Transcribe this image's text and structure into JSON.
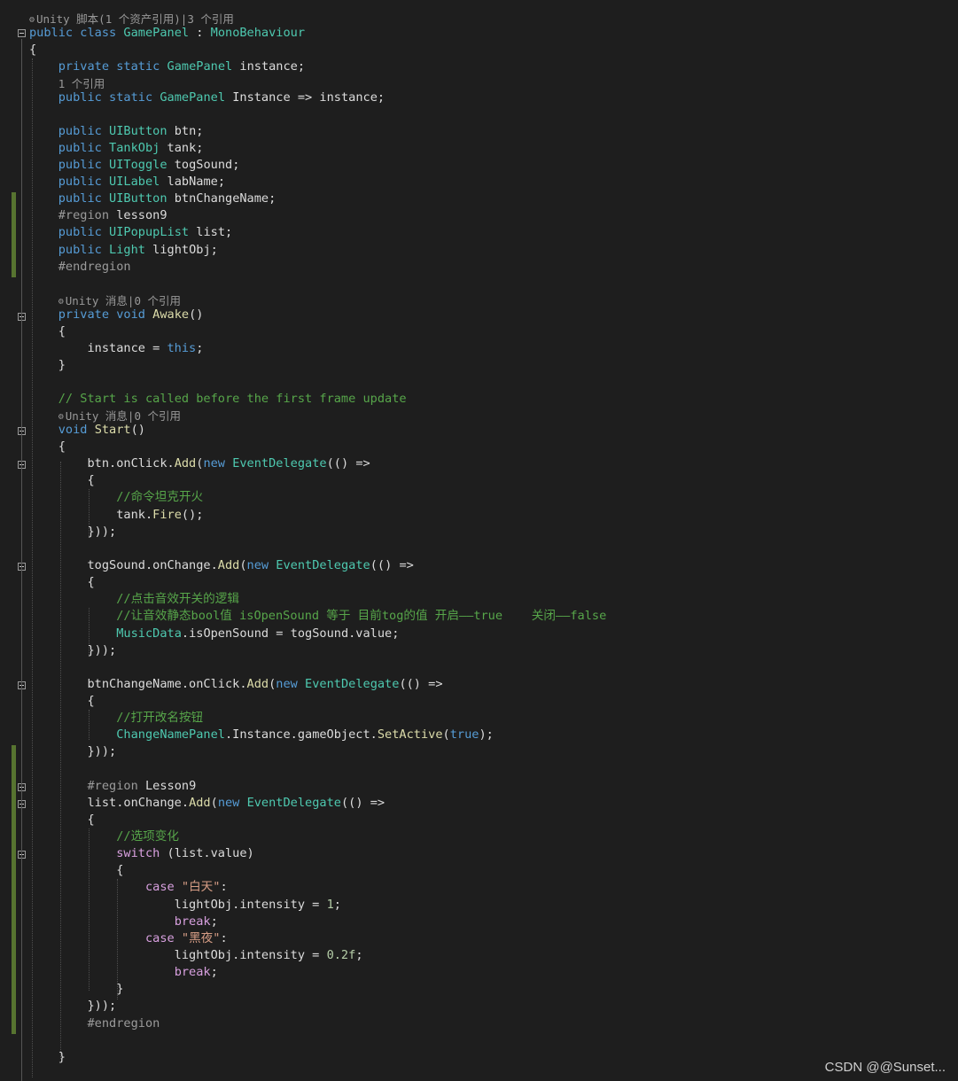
{
  "theme": {
    "background": "#1e1e1e",
    "keyword": "#569cd6",
    "type": "#4ec9b0",
    "method": "#dcdcaa",
    "string": "#d69d85",
    "comment": "#57a64a",
    "number": "#b5cea8",
    "control": "#d8a0df",
    "preprocessor": "#9b9b9b",
    "codelens": "#999999",
    "change_bar": "#577430"
  },
  "code_lines": [
    {
      "kind": "lens",
      "icon": "unity-icon",
      "text": "Unity 脚本(1 个资产引用)|3 个引用"
    },
    {
      "tokens": [
        [
          "kw",
          "public"
        ],
        [
          "p",
          " "
        ],
        [
          "kw",
          "class"
        ],
        [
          "p",
          " "
        ],
        [
          "type",
          "GamePanel"
        ],
        [
          "p",
          " : "
        ],
        [
          "type",
          "MonoBehaviour"
        ]
      ]
    },
    {
      "tokens": [
        [
          "p",
          "{"
        ]
      ]
    },
    {
      "tokens": [
        [
          "p",
          "    "
        ],
        [
          "kw",
          "private"
        ],
        [
          "p",
          " "
        ],
        [
          "kw",
          "static"
        ],
        [
          "p",
          " "
        ],
        [
          "type",
          "GamePanel"
        ],
        [
          "p",
          " instance;"
        ]
      ]
    },
    {
      "kind": "lens",
      "text": "    1 个引用"
    },
    {
      "tokens": [
        [
          "p",
          "    "
        ],
        [
          "kw",
          "public"
        ],
        [
          "p",
          " "
        ],
        [
          "kw",
          "static"
        ],
        [
          "p",
          " "
        ],
        [
          "type",
          "GamePanel"
        ],
        [
          "p",
          " Instance => instance;"
        ]
      ]
    },
    {
      "tokens": []
    },
    {
      "tokens": [
        [
          "p",
          "    "
        ],
        [
          "kw",
          "public"
        ],
        [
          "p",
          " "
        ],
        [
          "type",
          "UIButton"
        ],
        [
          "p",
          " btn;"
        ]
      ]
    },
    {
      "tokens": [
        [
          "p",
          "    "
        ],
        [
          "kw",
          "public"
        ],
        [
          "p",
          " "
        ],
        [
          "type",
          "TankObj"
        ],
        [
          "p",
          " tank;"
        ]
      ]
    },
    {
      "tokens": [
        [
          "p",
          "    "
        ],
        [
          "kw",
          "public"
        ],
        [
          "p",
          " "
        ],
        [
          "type",
          "UIToggle"
        ],
        [
          "p",
          " togSound;"
        ]
      ]
    },
    {
      "tokens": [
        [
          "p",
          "    "
        ],
        [
          "kw",
          "public"
        ],
        [
          "p",
          " "
        ],
        [
          "type",
          "UILabel"
        ],
        [
          "p",
          " labName;"
        ]
      ]
    },
    {
      "tokens": [
        [
          "p",
          "    "
        ],
        [
          "kw",
          "public"
        ],
        [
          "p",
          " "
        ],
        [
          "type",
          "UIButton"
        ],
        [
          "p",
          " btnChangeName;"
        ]
      ]
    },
    {
      "tokens": [
        [
          "p",
          "    "
        ],
        [
          "pre",
          "#region"
        ],
        [
          "p",
          " lesson9"
        ]
      ]
    },
    {
      "tokens": [
        [
          "p",
          "    "
        ],
        [
          "kw",
          "public"
        ],
        [
          "p",
          " "
        ],
        [
          "type",
          "UIPopupList"
        ],
        [
          "p",
          " list;"
        ]
      ]
    },
    {
      "tokens": [
        [
          "p",
          "    "
        ],
        [
          "kw",
          "public"
        ],
        [
          "p",
          " "
        ],
        [
          "type",
          "Light"
        ],
        [
          "p",
          " lightObj;"
        ]
      ]
    },
    {
      "tokens": [
        [
          "p",
          "    "
        ],
        [
          "pre",
          "#endregion"
        ]
      ]
    },
    {
      "tokens": []
    },
    {
      "kind": "lens",
      "icon": "unity-icon",
      "text": "    Unity 消息|0 个引用"
    },
    {
      "tokens": [
        [
          "p",
          "    "
        ],
        [
          "kw",
          "private"
        ],
        [
          "p",
          " "
        ],
        [
          "kw",
          "void"
        ],
        [
          "p",
          " "
        ],
        [
          "method",
          "Awake"
        ],
        [
          "p",
          "()"
        ]
      ]
    },
    {
      "tokens": [
        [
          "p",
          "    {"
        ]
      ]
    },
    {
      "tokens": [
        [
          "p",
          "        instance = "
        ],
        [
          "kw",
          "this"
        ],
        [
          "p",
          ";"
        ]
      ]
    },
    {
      "tokens": [
        [
          "p",
          "    }"
        ]
      ]
    },
    {
      "tokens": []
    },
    {
      "tokens": [
        [
          "p",
          "    "
        ],
        [
          "com",
          "// Start is called before the first frame update"
        ]
      ]
    },
    {
      "kind": "lens",
      "icon": "unity-icon",
      "text": "    Unity 消息|0 个引用"
    },
    {
      "tokens": [
        [
          "p",
          "    "
        ],
        [
          "kw",
          "void"
        ],
        [
          "p",
          " "
        ],
        [
          "method",
          "Start"
        ],
        [
          "p",
          "()"
        ]
      ]
    },
    {
      "tokens": [
        [
          "p",
          "    {"
        ]
      ]
    },
    {
      "tokens": [
        [
          "p",
          "        btn.onClick."
        ],
        [
          "method",
          "Add"
        ],
        [
          "p",
          "("
        ],
        [
          "kw",
          "new"
        ],
        [
          "p",
          " "
        ],
        [
          "type",
          "EventDelegate"
        ],
        [
          "p",
          "(() =>"
        ]
      ]
    },
    {
      "tokens": [
        [
          "p",
          "        {"
        ]
      ]
    },
    {
      "tokens": [
        [
          "p",
          "            "
        ],
        [
          "com",
          "//命令坦克开火"
        ]
      ]
    },
    {
      "tokens": [
        [
          "p",
          "            tank."
        ],
        [
          "method",
          "Fire"
        ],
        [
          "p",
          "();"
        ]
      ]
    },
    {
      "tokens": [
        [
          "p",
          "        }));"
        ]
      ]
    },
    {
      "tokens": []
    },
    {
      "tokens": [
        [
          "p",
          "        togSound.onChange."
        ],
        [
          "method",
          "Add"
        ],
        [
          "p",
          "("
        ],
        [
          "kw",
          "new"
        ],
        [
          "p",
          " "
        ],
        [
          "type",
          "EventDelegate"
        ],
        [
          "p",
          "(() =>"
        ]
      ]
    },
    {
      "tokens": [
        [
          "p",
          "        {"
        ]
      ]
    },
    {
      "tokens": [
        [
          "p",
          "            "
        ],
        [
          "com",
          "//点击音效开关的逻辑"
        ]
      ]
    },
    {
      "tokens": [
        [
          "p",
          "            "
        ],
        [
          "com",
          "//让音效静态bool值 isOpenSound 等于 目前tog的值 开启——true    关闭——false"
        ]
      ]
    },
    {
      "tokens": [
        [
          "p",
          "            "
        ],
        [
          "type",
          "MusicData"
        ],
        [
          "p",
          ".isOpenSound = togSound.value;"
        ]
      ]
    },
    {
      "tokens": [
        [
          "p",
          "        }));"
        ]
      ]
    },
    {
      "tokens": []
    },
    {
      "tokens": [
        [
          "p",
          "        btnChangeName.onClick."
        ],
        [
          "method",
          "Add"
        ],
        [
          "p",
          "("
        ],
        [
          "kw",
          "new"
        ],
        [
          "p",
          " "
        ],
        [
          "type",
          "EventDelegate"
        ],
        [
          "p",
          "(() =>"
        ]
      ]
    },
    {
      "tokens": [
        [
          "p",
          "        {"
        ]
      ]
    },
    {
      "tokens": [
        [
          "p",
          "            "
        ],
        [
          "com",
          "//打开改名按钮"
        ]
      ]
    },
    {
      "tokens": [
        [
          "p",
          "            "
        ],
        [
          "type",
          "ChangeNamePanel"
        ],
        [
          "p",
          ".Instance.gameObject."
        ],
        [
          "method",
          "SetActive"
        ],
        [
          "p",
          "("
        ],
        [
          "kw",
          "true"
        ],
        [
          "p",
          ");"
        ]
      ]
    },
    {
      "tokens": [
        [
          "p",
          "        }));"
        ]
      ]
    },
    {
      "tokens": []
    },
    {
      "tokens": [
        [
          "p",
          "        "
        ],
        [
          "pre",
          "#region"
        ],
        [
          "p",
          " Lesson9"
        ]
      ]
    },
    {
      "tokens": [
        [
          "p",
          "        list.onChange."
        ],
        [
          "method",
          "Add"
        ],
        [
          "p",
          "("
        ],
        [
          "kw",
          "new"
        ],
        [
          "p",
          " "
        ],
        [
          "type",
          "EventDelegate"
        ],
        [
          "p",
          "(() =>"
        ]
      ]
    },
    {
      "tokens": [
        [
          "p",
          "        {"
        ]
      ]
    },
    {
      "tokens": [
        [
          "p",
          "            "
        ],
        [
          "com",
          "//选项变化"
        ]
      ]
    },
    {
      "tokens": [
        [
          "p",
          "            "
        ],
        [
          "ctrl",
          "switch"
        ],
        [
          "p",
          " (list.value)"
        ]
      ]
    },
    {
      "tokens": [
        [
          "p",
          "            {"
        ]
      ]
    },
    {
      "tokens": [
        [
          "p",
          "                "
        ],
        [
          "ctrl",
          "case"
        ],
        [
          "p",
          " "
        ],
        [
          "str",
          "\"白天\""
        ],
        [
          "p",
          ":"
        ]
      ]
    },
    {
      "tokens": [
        [
          "p",
          "                    lightObj.intensity = "
        ],
        [
          "num",
          "1"
        ],
        [
          "p",
          ";"
        ]
      ]
    },
    {
      "tokens": [
        [
          "p",
          "                    "
        ],
        [
          "ctrl",
          "break"
        ],
        [
          "p",
          ";"
        ]
      ]
    },
    {
      "tokens": [
        [
          "p",
          "                "
        ],
        [
          "ctrl",
          "case"
        ],
        [
          "p",
          " "
        ],
        [
          "str",
          "\"黑夜\""
        ],
        [
          "p",
          ":"
        ]
      ]
    },
    {
      "tokens": [
        [
          "p",
          "                    lightObj.intensity = "
        ],
        [
          "num",
          "0.2f"
        ],
        [
          "p",
          ";"
        ]
      ]
    },
    {
      "tokens": [
        [
          "p",
          "                    "
        ],
        [
          "ctrl",
          "break"
        ],
        [
          "p",
          ";"
        ]
      ]
    },
    {
      "tokens": [
        [
          "p",
          "            }"
        ]
      ]
    },
    {
      "tokens": [
        [
          "p",
          "        }));"
        ]
      ]
    },
    {
      "tokens": [
        [
          "p",
          "        "
        ],
        [
          "pre",
          "#endregion"
        ]
      ]
    },
    {
      "tokens": []
    },
    {
      "tokens": [
        [
          "p",
          "    }"
        ]
      ]
    }
  ],
  "watermark": "CSDN @@Sunset..."
}
